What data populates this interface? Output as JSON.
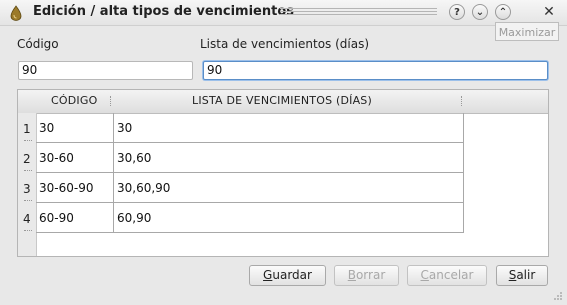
{
  "window": {
    "title": "Edición / alta tipos de vencimientos",
    "tooltip": "Maximizar"
  },
  "form": {
    "codigo_label": "Código",
    "codigo_value": "90",
    "lista_label": "Lista de vencimientos (días)",
    "lista_value": "90"
  },
  "table": {
    "headers": [
      "CÓDIGO",
      "LISTA DE VENCIMIENTOS (DÍAS)"
    ],
    "rows": [
      {
        "num": "1",
        "codigo": "30",
        "lista": "30"
      },
      {
        "num": "2",
        "codigo": "30-60",
        "lista": "30,60"
      },
      {
        "num": "3",
        "codigo": "30-60-90",
        "lista": "30,60,90"
      },
      {
        "num": "4",
        "codigo": "60-90",
        "lista": "60,90"
      }
    ]
  },
  "buttons": {
    "guardar": "Guardar",
    "borrar": "Borrar",
    "cancelar": "Cancelar",
    "salir": "Salir"
  }
}
